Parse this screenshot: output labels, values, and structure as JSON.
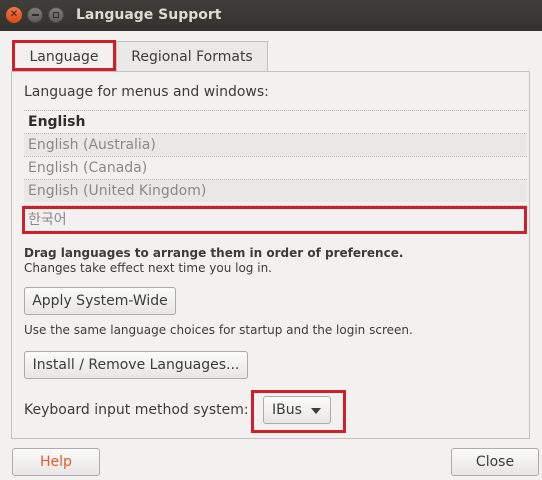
{
  "window": {
    "title": "Language Support"
  },
  "tabs": [
    {
      "label": "Language",
      "active": true
    },
    {
      "label": "Regional Formats",
      "active": false
    }
  ],
  "language_section": {
    "heading": "Language for menus and windows:",
    "languages": [
      "English",
      "English (Australia)",
      "English (Canada)",
      "English (United Kingdom)",
      "한국어"
    ],
    "drag_hint": "Drag languages to arrange them in order of preference.",
    "login_hint": "Changes take effect next time you log in."
  },
  "buttons": {
    "apply_system_wide": "Apply System-Wide",
    "apply_note": "Use the same language choices for startup and the login screen.",
    "install_remove": "Install / Remove Languages...",
    "help": "Help",
    "close": "Close"
  },
  "keyboard": {
    "label": "Keyboard input method system:",
    "selected": "IBus"
  },
  "colors": {
    "highlight": "#cf1f2b",
    "titlebar": "#3c3b37",
    "help_text": "#e05b2b"
  },
  "icons": {
    "close": "close-icon",
    "minimize": "minimize-icon",
    "maximize": "maximize-icon",
    "dropdown": "chevron-down-icon"
  }
}
